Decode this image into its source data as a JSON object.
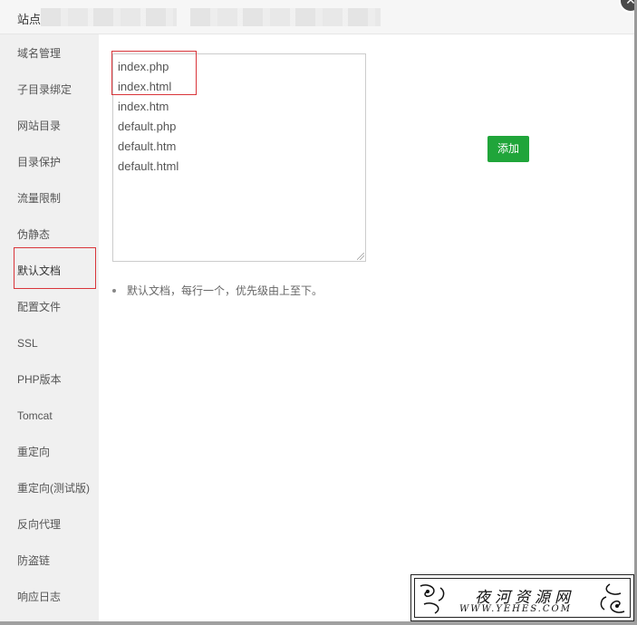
{
  "header": {
    "title": "站点"
  },
  "close_icon": "close-icon",
  "sidebar": {
    "items": [
      {
        "label": "域名管理"
      },
      {
        "label": "子目录绑定"
      },
      {
        "label": "网站目录"
      },
      {
        "label": "目录保护"
      },
      {
        "label": "流量限制"
      },
      {
        "label": "伪静态"
      },
      {
        "label": "默认文档"
      },
      {
        "label": "配置文件"
      },
      {
        "label": "SSL"
      },
      {
        "label": "PHP版本"
      },
      {
        "label": "Tomcat"
      },
      {
        "label": "重定向"
      },
      {
        "label": "重定向(测试版)"
      },
      {
        "label": "反向代理"
      },
      {
        "label": "防盗链"
      },
      {
        "label": "响应日志"
      }
    ],
    "active_index": 6
  },
  "default_docs": {
    "lines": [
      "index.php",
      "index.html",
      "index.htm",
      "default.php",
      "default.htm",
      "default.html"
    ]
  },
  "add_button": {
    "label": "添加"
  },
  "hint": {
    "text": "默认文档，每行一个，优先级由上至下。"
  },
  "watermark": {
    "chinese": "夜河资源网",
    "english": "WWW.YEHES.COM"
  },
  "colors": {
    "accent_green": "#20a53a",
    "highlight_red": "#d9353a",
    "sidebar_bg": "#f0f0f0"
  }
}
